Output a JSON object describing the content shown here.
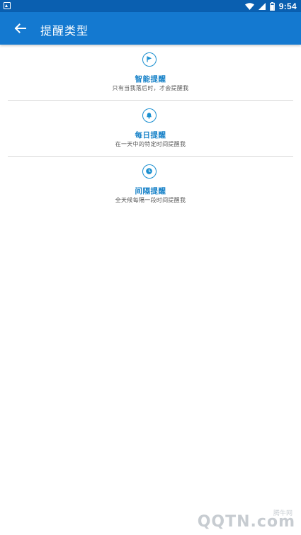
{
  "status_bar": {
    "time": "9:54",
    "icons": [
      "wifi-icon",
      "signal-icon",
      "battery-icon"
    ]
  },
  "app_bar": {
    "title": "提醒类型",
    "back_icon": "arrow-left-icon"
  },
  "reminder_types": [
    {
      "name": "智能提醒",
      "description": "只有当我落后时，才会提醒我",
      "icon": "flag-icon"
    },
    {
      "name": "每日提醒",
      "description": "在一天中的特定时间提醒我",
      "icon": "bell-icon"
    },
    {
      "name": "间隔提醒",
      "description": "全天候每隔一段时间提醒我",
      "icon": "clock-icon"
    }
  ],
  "watermark": {
    "text": "QQTN.com",
    "small": "腾牛网"
  },
  "colors": {
    "status_bar": "#0a5fb0",
    "app_bar": "#1479d0",
    "accent": "#1681c8"
  }
}
